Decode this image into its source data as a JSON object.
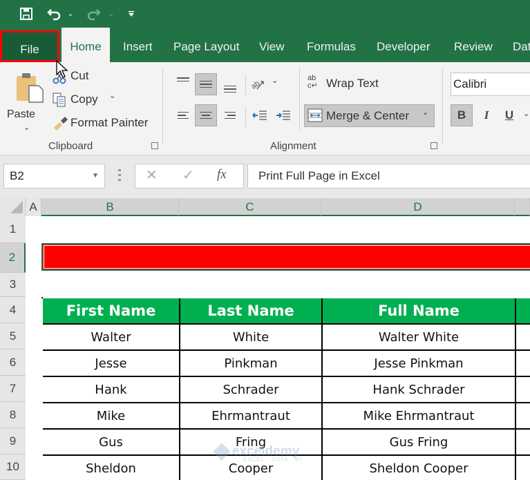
{
  "quick_access": {
    "icons": [
      "save-icon",
      "undo-icon",
      "undo-dropdown-icon",
      "redo-icon",
      "redo-dropdown-icon",
      "customize-qat-icon"
    ]
  },
  "tabs": [
    {
      "label": "File",
      "state": "highlighted"
    },
    {
      "label": "Home",
      "state": "active"
    },
    {
      "label": "Insert"
    },
    {
      "label": "Page Layout"
    },
    {
      "label": "View"
    },
    {
      "label": "Formulas"
    },
    {
      "label": "Developer"
    },
    {
      "label": "Review"
    },
    {
      "label": "Data"
    }
  ],
  "ribbon": {
    "clipboard": {
      "label": "Clipboard",
      "paste": "Paste",
      "cut": "Cut",
      "copy": "Copy",
      "format_painter": "Format Painter"
    },
    "alignment": {
      "label": "Alignment",
      "wrap_text": "Wrap Text",
      "merge_center": "Merge & Center"
    },
    "font": {
      "font_name": "Calibri",
      "bold": "B",
      "italic": "I",
      "underline": "U"
    }
  },
  "formula_bar": {
    "name_box": "B2",
    "cancel_icon": "✕",
    "enter_icon": "✓",
    "fx_label": "fx",
    "formula": "Print Full Page in Excel"
  },
  "sheet": {
    "columns": [
      "A",
      "B",
      "C",
      "D"
    ],
    "selected_column": "B",
    "rows": [
      "1",
      "2",
      "3",
      "4",
      "5",
      "6",
      "7",
      "8",
      "9",
      "10"
    ],
    "selected_row": "2",
    "table_headers": [
      "First Name",
      "Last Name",
      "Full Name"
    ],
    "table_rows": [
      [
        "Walter",
        "White",
        "Walter White"
      ],
      [
        "Jesse",
        "Pinkman",
        "Jesse Pinkman"
      ],
      [
        "Hank",
        "Schrader",
        "Hank Schrader"
      ],
      [
        "Mike",
        "Ehrmantraut",
        "Mike  Ehrmantraut"
      ],
      [
        "Gus",
        "Fring",
        "Gus Fring"
      ],
      [
        "Sheldon",
        "Cooper",
        "Sheldon Cooper"
      ]
    ]
  },
  "watermark": {
    "brand": "exceldemy",
    "tagline": "EXCEL · DATA · BI"
  },
  "colors": {
    "excel_green": "#217346",
    "file_tab_highlight": "#ff0000",
    "header_fill": "#00b050",
    "merged_fill": "#ff0000"
  }
}
